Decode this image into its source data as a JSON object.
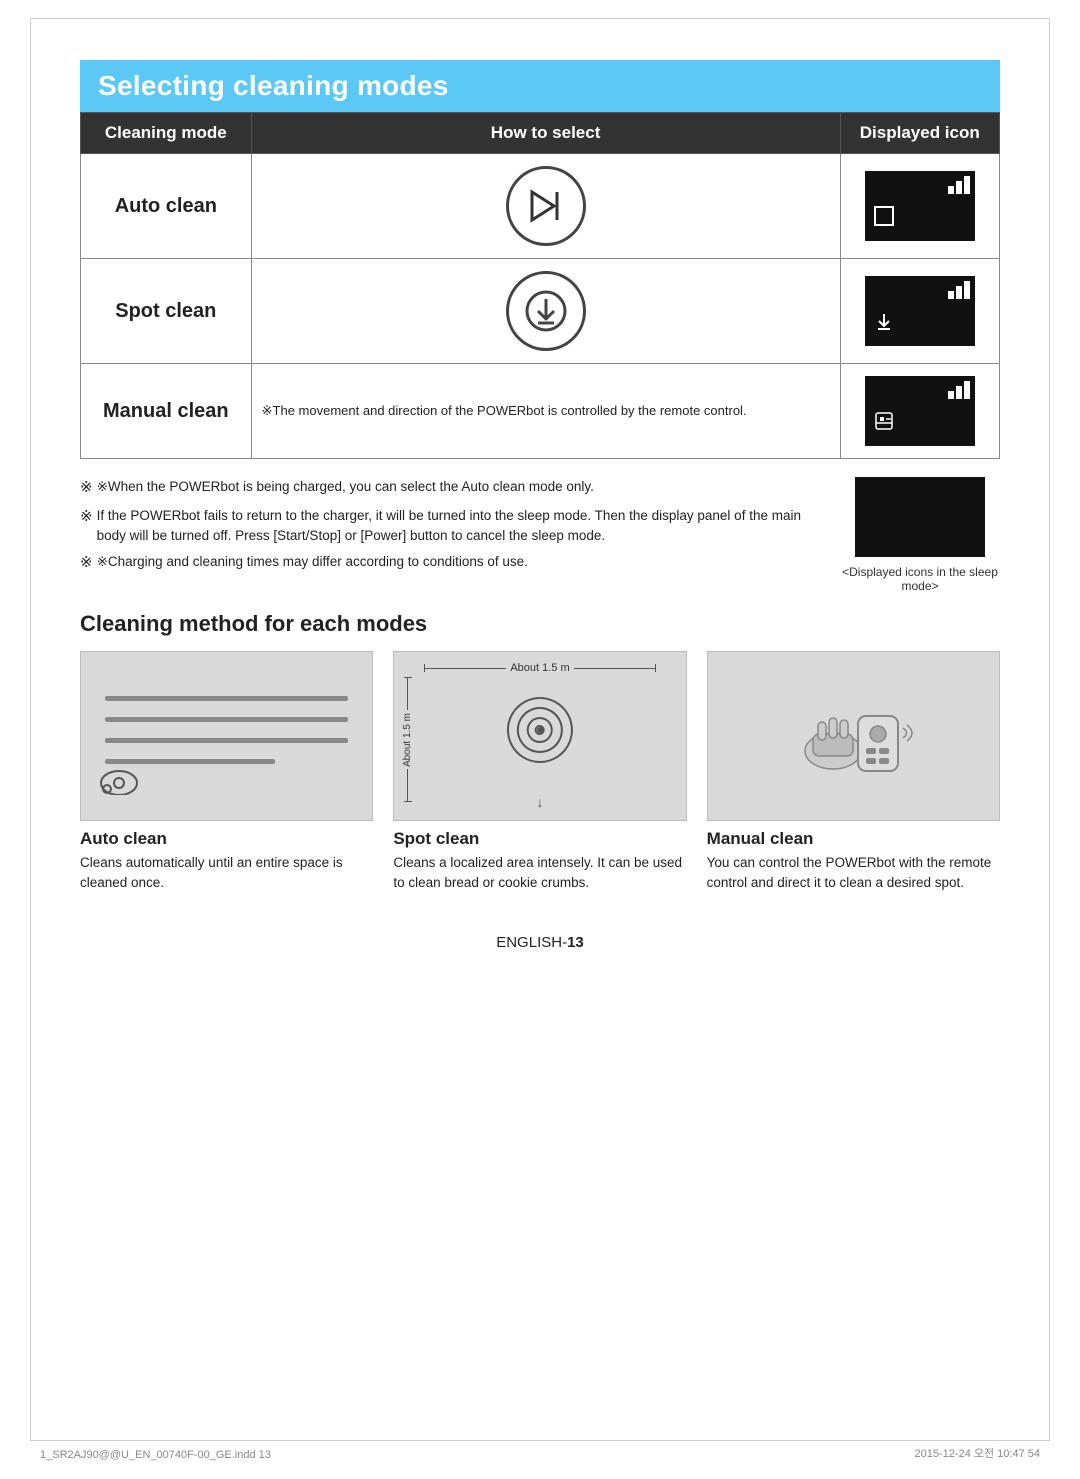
{
  "page": {
    "title": "Selecting cleaning modes",
    "table": {
      "headers": [
        "Cleaning mode",
        "How to select",
        "Displayed icon"
      ],
      "rows": [
        {
          "mode": "Auto clean",
          "how": "button",
          "how_icon": "play-skip",
          "icon_symbol": ""
        },
        {
          "mode": "Spot clean",
          "how": "button",
          "how_icon": "spot",
          "icon_symbol": "⇩"
        },
        {
          "mode": "Manual clean",
          "how": "note",
          "how_text": "※The movement and direction of the POWERbot is controlled by the remote control.",
          "icon_symbol": "🎮"
        }
      ]
    },
    "notes": [
      "※When the POWERbot is being charged, you can select the Auto clean mode only.",
      "※If the POWERbot fails to return to the charger, it will be turned into the sleep mode. Then the display panel of the main body will be turned off. Press [Start/Stop] or [Power] button to cancel the sleep mode.",
      "※Charging and cleaning times may differ according to conditions of use."
    ],
    "sleep_caption": "<Displayed icons in the sleep mode>",
    "method_section": {
      "title": "Cleaning method for each modes",
      "items": [
        {
          "label": "Auto clean",
          "desc": "Cleans automatically until an entire space is cleaned once."
        },
        {
          "label": "Spot clean",
          "desc": "Cleans a localized area intensely. It can be used to clean bread or cookie crumbs.",
          "measure_h": "About 1.5 m",
          "measure_v": "About 1.5 m"
        },
        {
          "label": "Manual clean",
          "desc": "You can control the POWERbot with the remote control and direct it to clean a desired spot."
        }
      ]
    },
    "footer": {
      "page_label": "ENGLISH-",
      "page_number": "13",
      "filename": "1_SR2AJ90@@U_EN_00740F-00_GE.indd   13",
      "date": "2015-12-24   오전 10:47   54"
    }
  }
}
